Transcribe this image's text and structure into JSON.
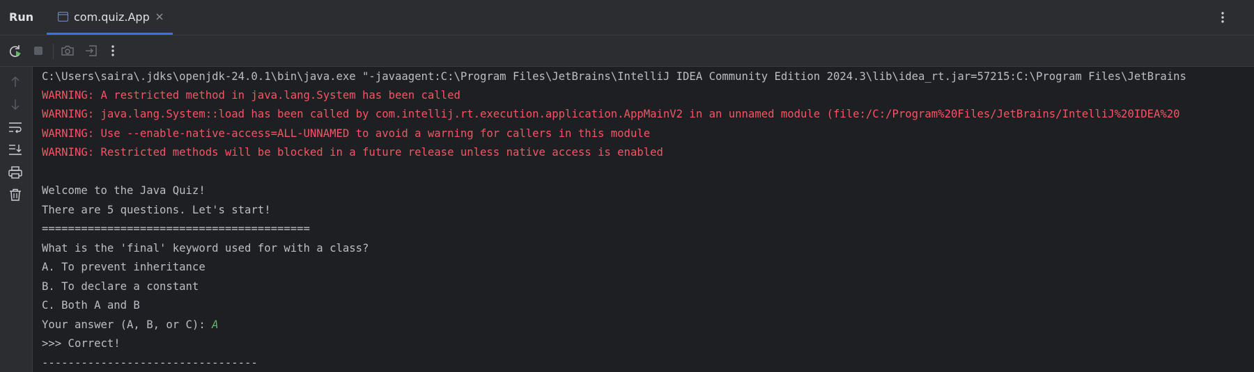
{
  "header": {
    "title": "Run",
    "tab": {
      "label": "com.quiz.App",
      "icon": "console-window-icon"
    },
    "icons": {
      "close": "close-icon",
      "more": "more-vertical-icon"
    }
  },
  "toolbar": {
    "icons": [
      "rerun-icon",
      "stop-icon",
      "camera-icon",
      "exit-icon",
      "more-vertical-icon"
    ]
  },
  "gutter": {
    "icons": [
      "arrow-up-icon",
      "arrow-down-icon",
      "soft-wrap-icon",
      "scroll-to-end-icon",
      "print-icon",
      "trash-icon"
    ]
  },
  "colors": {
    "background": "#1e1f22",
    "panel": "#2b2d30",
    "accent": "#3574f0",
    "warning": "#f75464",
    "input": "#5fb865",
    "text": "#bcbec4"
  },
  "console": {
    "lines": [
      {
        "type": "normal",
        "text": "C:\\Users\\saira\\.jdks\\openjdk-24.0.1\\bin\\java.exe \"-javaagent:C:\\Program Files\\JetBrains\\IntelliJ IDEA Community Edition 2024.3\\lib\\idea_rt.jar=57215:C:\\Program Files\\JetBrains"
      },
      {
        "type": "warning",
        "text": "WARNING: A restricted method in java.lang.System has been called"
      },
      {
        "type": "warning",
        "text": "WARNING: java.lang.System::load has been called by com.intellij.rt.execution.application.AppMainV2 in an unnamed module (file:/C:/Program%20Files/JetBrains/IntelliJ%20IDEA%20"
      },
      {
        "type": "warning",
        "text": "WARNING: Use --enable-native-access=ALL-UNNAMED to avoid a warning for callers in this module"
      },
      {
        "type": "warning",
        "text": "WARNING: Restricted methods will be blocked in a future release unless native access is enabled"
      },
      {
        "type": "normal",
        "text": ""
      },
      {
        "type": "normal",
        "text": "Welcome to the Java Quiz!"
      },
      {
        "type": "normal",
        "text": "There are 5 questions. Let's start!"
      },
      {
        "type": "normal",
        "text": "========================================="
      },
      {
        "type": "normal",
        "text": "What is the 'final' keyword used for with a class?"
      },
      {
        "type": "normal",
        "text": "A. To prevent inheritance"
      },
      {
        "type": "normal",
        "text": "B. To declare a constant"
      },
      {
        "type": "normal",
        "text": "C. Both A and B"
      },
      {
        "type": "prompt",
        "text": "Your answer (A, B, or C): ",
        "input": "A"
      },
      {
        "type": "normal",
        "text": ">>> Correct!"
      },
      {
        "type": "normal",
        "text": "---------------------------------"
      }
    ]
  }
}
